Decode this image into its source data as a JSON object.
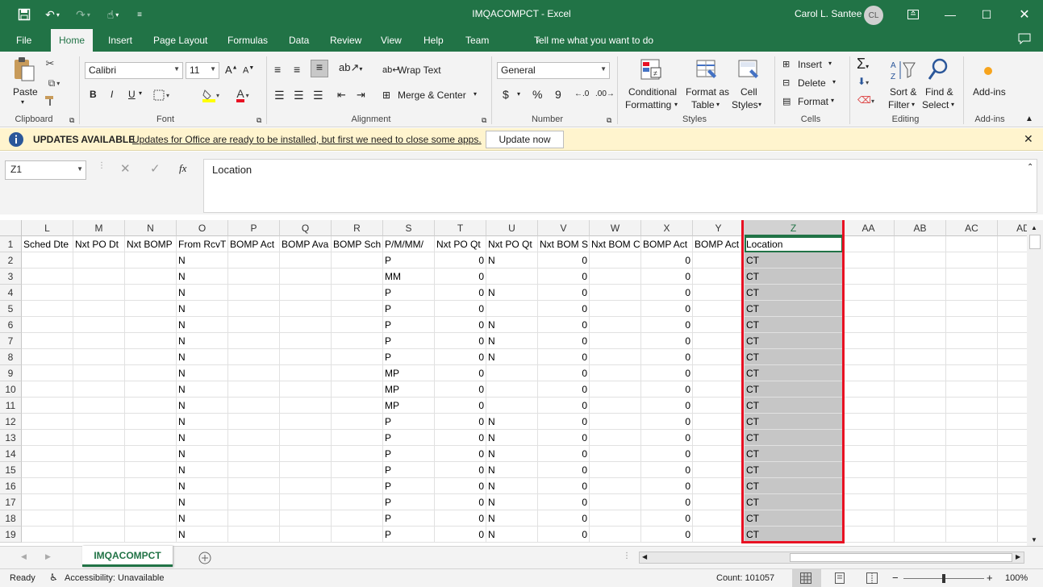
{
  "window": {
    "title": "IMQACOMPCT  -  Excel",
    "user": "Carol L. Santee",
    "avatar_initials": "CL"
  },
  "menu": {
    "tabs": [
      "File",
      "Home",
      "Insert",
      "Page Layout",
      "Formulas",
      "Data",
      "Review",
      "View",
      "Help",
      "Team"
    ],
    "tell_me": "Tell me what you want to do"
  },
  "ribbon": {
    "clipboard": {
      "paste": "Paste",
      "label": "Clipboard"
    },
    "font": {
      "name": "Calibri",
      "size": "11",
      "bold": "B",
      "italic": "I",
      "underline": "U",
      "label": "Font"
    },
    "alignment": {
      "wrap": "Wrap Text",
      "merge": "Merge & Center",
      "label": "Alignment"
    },
    "number": {
      "format": "General",
      "currency": "$",
      "percent": "%",
      "comma": "9",
      "label": "Number"
    },
    "styles": {
      "cond1": "Conditional",
      "cond2": "Formatting",
      "fmt1": "Format as",
      "fmt2": "Table",
      "cell1": "Cell",
      "cell2": "Styles",
      "label": "Styles"
    },
    "cells": {
      "insert": "Insert",
      "delete": "Delete",
      "format": "Format",
      "label": "Cells"
    },
    "editing": {
      "sort1": "Sort &",
      "sort2": "Filter",
      "find1": "Find &",
      "find2": "Select",
      "label": "Editing"
    },
    "addins": {
      "btn": "Add-ins",
      "label": "Add-ins"
    }
  },
  "update_bar": {
    "title": "UPDATES AVAILABLE",
    "message": "Updates for Office are ready to be installed, but first we need to close some apps.",
    "button": "Update now"
  },
  "formula_bar": {
    "name_box": "Z1",
    "fx": "fx",
    "content": "Location"
  },
  "grid": {
    "columns": [
      "L",
      "M",
      "N",
      "O",
      "P",
      "Q",
      "R",
      "S",
      "T",
      "U",
      "V",
      "W",
      "X",
      "Y",
      "Z",
      "AA",
      "AB",
      "AC",
      "AD"
    ],
    "headers": [
      "Sched Dte",
      "Nxt PO Dt",
      "Nxt BOMP",
      "From RcvT",
      "BOMP Act",
      "BOMP Ava",
      "BOMP Sch",
      "P/M/MM/",
      "Nxt PO Qt",
      "Nxt PO Qt",
      "Nxt BOM S",
      "Nxt BOM C",
      "BOMP Act",
      "BOMP Act",
      "Location"
    ],
    "row_numbers": [
      "1",
      "2",
      "3",
      "4",
      "5",
      "6",
      "7",
      "8",
      "9",
      "10",
      "11",
      "12",
      "13",
      "14",
      "15",
      "16",
      "17",
      "18",
      "19"
    ],
    "rows": [
      {
        "O": "N",
        "S": "P",
        "T": "0",
        "U": "N",
        "V": "0",
        "X": "0",
        "Z": "CT"
      },
      {
        "O": "N",
        "S": "MM",
        "T": "0",
        "U": "",
        "V": "0",
        "X": "0",
        "Z": "CT"
      },
      {
        "O": "N",
        "S": "P",
        "T": "0",
        "U": "N",
        "V": "0",
        "X": "0",
        "Z": "CT"
      },
      {
        "O": "N",
        "S": "P",
        "T": "0",
        "U": "",
        "V": "0",
        "X": "0",
        "Z": "CT"
      },
      {
        "O": "N",
        "S": "P",
        "T": "0",
        "U": "N",
        "V": "0",
        "X": "0",
        "Z": "CT"
      },
      {
        "O": "N",
        "S": "P",
        "T": "0",
        "U": "N",
        "V": "0",
        "X": "0",
        "Z": "CT"
      },
      {
        "O": "N",
        "S": "P",
        "T": "0",
        "U": "N",
        "V": "0",
        "X": "0",
        "Z": "CT"
      },
      {
        "O": "N",
        "S": "MP",
        "T": "0",
        "U": "",
        "V": "0",
        "X": "0",
        "Z": "CT"
      },
      {
        "O": "N",
        "S": "MP",
        "T": "0",
        "U": "",
        "V": "0",
        "X": "0",
        "Z": "CT"
      },
      {
        "O": "N",
        "S": "MP",
        "T": "0",
        "U": "",
        "V": "0",
        "X": "0",
        "Z": "CT"
      },
      {
        "O": "N",
        "S": "P",
        "T": "0",
        "U": "N",
        "V": "0",
        "X": "0",
        "Z": "CT"
      },
      {
        "O": "N",
        "S": "P",
        "T": "0",
        "U": "N",
        "V": "0",
        "X": "0",
        "Z": "CT"
      },
      {
        "O": "N",
        "S": "P",
        "T": "0",
        "U": "N",
        "V": "0",
        "X": "0",
        "Z": "CT"
      },
      {
        "O": "N",
        "S": "P",
        "T": "0",
        "U": "N",
        "V": "0",
        "X": "0",
        "Z": "CT"
      },
      {
        "O": "N",
        "S": "P",
        "T": "0",
        "U": "N",
        "V": "0",
        "X": "0",
        "Z": "CT"
      },
      {
        "O": "N",
        "S": "P",
        "T": "0",
        "U": "N",
        "V": "0",
        "X": "0",
        "Z": "CT"
      },
      {
        "O": "N",
        "S": "P",
        "T": "0",
        "U": "N",
        "V": "0",
        "X": "0",
        "Z": "CT"
      },
      {
        "O": "N",
        "S": "P",
        "T": "0",
        "U": "N",
        "V": "0",
        "X": "0",
        "Z": "CT"
      }
    ]
  },
  "sheet": {
    "tab": "IMQACOMPCT"
  },
  "status": {
    "ready": "Ready",
    "accessibility": "Accessibility: Unavailable",
    "count": "Count: 101057",
    "zoom": "100%"
  },
  "colors": {
    "brand": "#217346",
    "highlight": "#e81123"
  }
}
